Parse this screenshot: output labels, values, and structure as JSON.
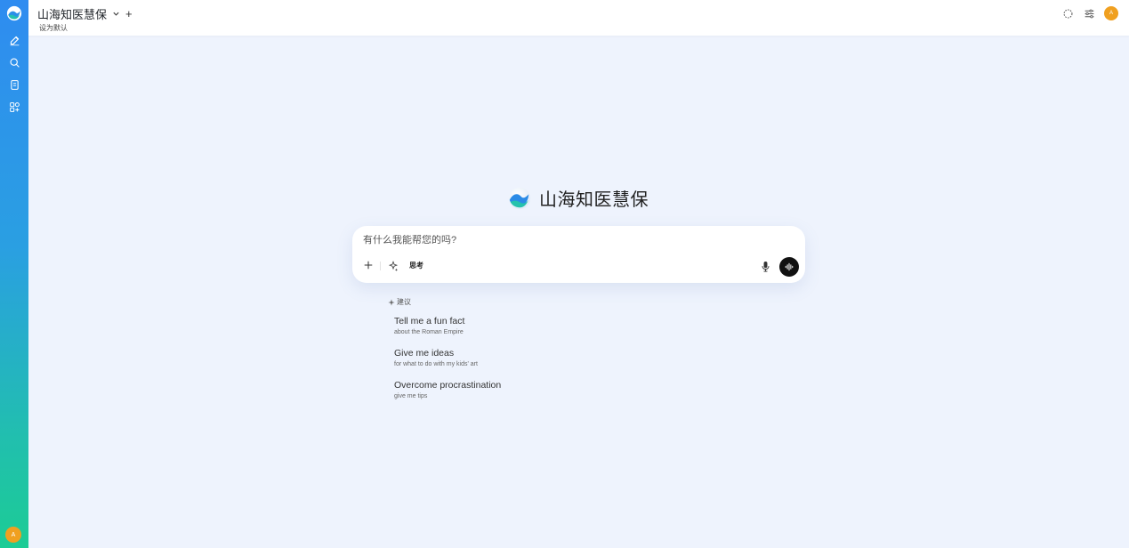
{
  "app": {
    "title": "山海知医慧保",
    "set_default": "设为默认",
    "brand_name": "山海知医慧保",
    "avatar_initial": "A"
  },
  "sidebar": {
    "items": [
      {
        "icon": "new-chat-icon"
      },
      {
        "icon": "search-icon"
      },
      {
        "icon": "notes-icon"
      },
      {
        "icon": "workspace-icon"
      }
    ]
  },
  "chat": {
    "placeholder": "有什么我能帮您的吗?",
    "think_label": "思考"
  },
  "suggestions": {
    "heading": "建议",
    "items": [
      {
        "title": "Tell me a fun fact",
        "subtitle": "about the Roman Empire"
      },
      {
        "title": "Give me ideas",
        "subtitle": "for what to do with my kids' art"
      },
      {
        "title": "Overcome procrastination",
        "subtitle": "give me tips"
      }
    ]
  },
  "colors": {
    "accent_avatar": "#f0a020",
    "sidebar_top": "#2f8cf0",
    "sidebar_bottom": "#1ccc95",
    "page_bg": "#eef3fd"
  }
}
